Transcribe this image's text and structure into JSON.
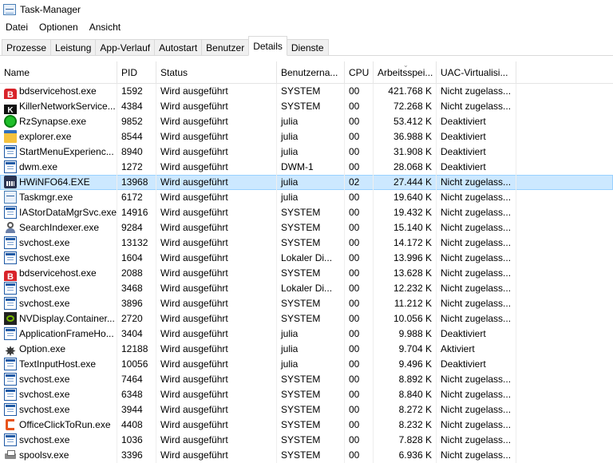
{
  "window": {
    "title": "Task-Manager"
  },
  "menu": [
    "Datei",
    "Optionen",
    "Ansicht"
  ],
  "tabs": [
    {
      "label": "Prozesse",
      "active": false
    },
    {
      "label": "Leistung",
      "active": false
    },
    {
      "label": "App-Verlauf",
      "active": false
    },
    {
      "label": "Autostart",
      "active": false
    },
    {
      "label": "Benutzer",
      "active": false
    },
    {
      "label": "Details",
      "active": true
    },
    {
      "label": "Dienste",
      "active": false
    }
  ],
  "columns": [
    {
      "label": "Name"
    },
    {
      "label": "PID"
    },
    {
      "label": "Status"
    },
    {
      "label": "Benutzerna..."
    },
    {
      "label": "CPU"
    },
    {
      "label": "Arbeitsspei..."
    },
    {
      "label": "UAC-Virtualisi..."
    }
  ],
  "sorted_column": "Arbeitsspei...",
  "sort_direction": "descending",
  "selected_row": 6,
  "rows": [
    {
      "icon": "bitdefender-icon",
      "name": "bdservicehost.exe",
      "pid": "1592",
      "status": "Wird ausgeführt",
      "user": "SYSTEM",
      "cpu": "00",
      "mem": "421.768 K",
      "uac": "Nicht zugelass..."
    },
    {
      "icon": "killer-network-icon",
      "name": "KillerNetworkService...",
      "pid": "4384",
      "status": "Wird ausgeführt",
      "user": "SYSTEM",
      "cpu": "00",
      "mem": "72.268 K",
      "uac": "Nicht zugelass..."
    },
    {
      "icon": "razer-icon",
      "name": "RzSynapse.exe",
      "pid": "9852",
      "status": "Wird ausgeführt",
      "user": "julia",
      "cpu": "00",
      "mem": "53.412 K",
      "uac": "Deaktiviert"
    },
    {
      "icon": "explorer-icon",
      "name": "explorer.exe",
      "pid": "8544",
      "status": "Wird ausgeführt",
      "user": "julia",
      "cpu": "00",
      "mem": "36.988 K",
      "uac": "Deaktiviert"
    },
    {
      "icon": "window-icon",
      "name": "StartMenuExperienc...",
      "pid": "8940",
      "status": "Wird ausgeführt",
      "user": "julia",
      "cpu": "00",
      "mem": "31.908 K",
      "uac": "Deaktiviert"
    },
    {
      "icon": "window-icon",
      "name": "dwm.exe",
      "pid": "1272",
      "status": "Wird ausgeführt",
      "user": "DWM-1",
      "cpu": "00",
      "mem": "28.068 K",
      "uac": "Deaktiviert"
    },
    {
      "icon": "hwinfo-icon",
      "name": "HWiNFO64.EXE",
      "pid": "13968",
      "status": "Wird ausgeführt",
      "user": "julia",
      "cpu": "02",
      "mem": "27.444 K",
      "uac": "Nicht zugelass..."
    },
    {
      "icon": "task-manager-icon",
      "name": "Taskmgr.exe",
      "pid": "6172",
      "status": "Wird ausgeführt",
      "user": "julia",
      "cpu": "00",
      "mem": "19.640 K",
      "uac": "Nicht zugelass..."
    },
    {
      "icon": "window-icon",
      "name": "IAStorDataMgrSvc.exe",
      "pid": "14916",
      "status": "Wird ausgeführt",
      "user": "SYSTEM",
      "cpu": "00",
      "mem": "19.432 K",
      "uac": "Nicht zugelass..."
    },
    {
      "icon": "search-indexer-icon",
      "name": "SearchIndexer.exe",
      "pid": "9284",
      "status": "Wird ausgeführt",
      "user": "SYSTEM",
      "cpu": "00",
      "mem": "15.140 K",
      "uac": "Nicht zugelass..."
    },
    {
      "icon": "window-icon",
      "name": "svchost.exe",
      "pid": "13132",
      "status": "Wird ausgeführt",
      "user": "SYSTEM",
      "cpu": "00",
      "mem": "14.172 K",
      "uac": "Nicht zugelass..."
    },
    {
      "icon": "window-icon",
      "name": "svchost.exe",
      "pid": "1604",
      "status": "Wird ausgeführt",
      "user": "Lokaler Di...",
      "cpu": "00",
      "mem": "13.996 K",
      "uac": "Nicht zugelass..."
    },
    {
      "icon": "bitdefender-icon",
      "name": "bdservicehost.exe",
      "pid": "2088",
      "status": "Wird ausgeführt",
      "user": "SYSTEM",
      "cpu": "00",
      "mem": "13.628 K",
      "uac": "Nicht zugelass..."
    },
    {
      "icon": "window-icon",
      "name": "svchost.exe",
      "pid": "3468",
      "status": "Wird ausgeführt",
      "user": "Lokaler Di...",
      "cpu": "00",
      "mem": "12.232 K",
      "uac": "Nicht zugelass..."
    },
    {
      "icon": "window-icon",
      "name": "svchost.exe",
      "pid": "3896",
      "status": "Wird ausgeführt",
      "user": "SYSTEM",
      "cpu": "00",
      "mem": "11.212 K",
      "uac": "Nicht zugelass..."
    },
    {
      "icon": "nvidia-icon",
      "name": "NVDisplay.Container...",
      "pid": "2720",
      "status": "Wird ausgeführt",
      "user": "SYSTEM",
      "cpu": "00",
      "mem": "10.056 K",
      "uac": "Nicht zugelass..."
    },
    {
      "icon": "window-icon",
      "name": "ApplicationFrameHo...",
      "pid": "3404",
      "status": "Wird ausgeführt",
      "user": "julia",
      "cpu": "00",
      "mem": "9.988 K",
      "uac": "Deaktiviert"
    },
    {
      "icon": "option-icon",
      "name": "Option.exe",
      "pid": "12188",
      "status": "Wird ausgeführt",
      "user": "julia",
      "cpu": "00",
      "mem": "9.704 K",
      "uac": "Aktiviert"
    },
    {
      "icon": "window-icon",
      "name": "TextInputHost.exe",
      "pid": "10056",
      "status": "Wird ausgeführt",
      "user": "julia",
      "cpu": "00",
      "mem": "9.496 K",
      "uac": "Deaktiviert"
    },
    {
      "icon": "window-icon",
      "name": "svchost.exe",
      "pid": "7464",
      "status": "Wird ausgeführt",
      "user": "SYSTEM",
      "cpu": "00",
      "mem": "8.892 K",
      "uac": "Nicht zugelass..."
    },
    {
      "icon": "window-icon",
      "name": "svchost.exe",
      "pid": "6348",
      "status": "Wird ausgeführt",
      "user": "SYSTEM",
      "cpu": "00",
      "mem": "8.840 K",
      "uac": "Nicht zugelass..."
    },
    {
      "icon": "window-icon",
      "name": "svchost.exe",
      "pid": "3944",
      "status": "Wird ausgeführt",
      "user": "SYSTEM",
      "cpu": "00",
      "mem": "8.272 K",
      "uac": "Nicht zugelass..."
    },
    {
      "icon": "office-icon",
      "name": "OfficeClickToRun.exe",
      "pid": "4408",
      "status": "Wird ausgeführt",
      "user": "SYSTEM",
      "cpu": "00",
      "mem": "8.232 K",
      "uac": "Nicht zugelass..."
    },
    {
      "icon": "window-icon",
      "name": "svchost.exe",
      "pid": "1036",
      "status": "Wird ausgeführt",
      "user": "SYSTEM",
      "cpu": "00",
      "mem": "7.828 K",
      "uac": "Nicht zugelass..."
    },
    {
      "icon": "printer-icon",
      "name": "spoolsv.exe",
      "pid": "3396",
      "status": "Wird ausgeführt",
      "user": "SYSTEM",
      "cpu": "00",
      "mem": "6.936 K",
      "uac": "Nicht zugelass..."
    }
  ]
}
